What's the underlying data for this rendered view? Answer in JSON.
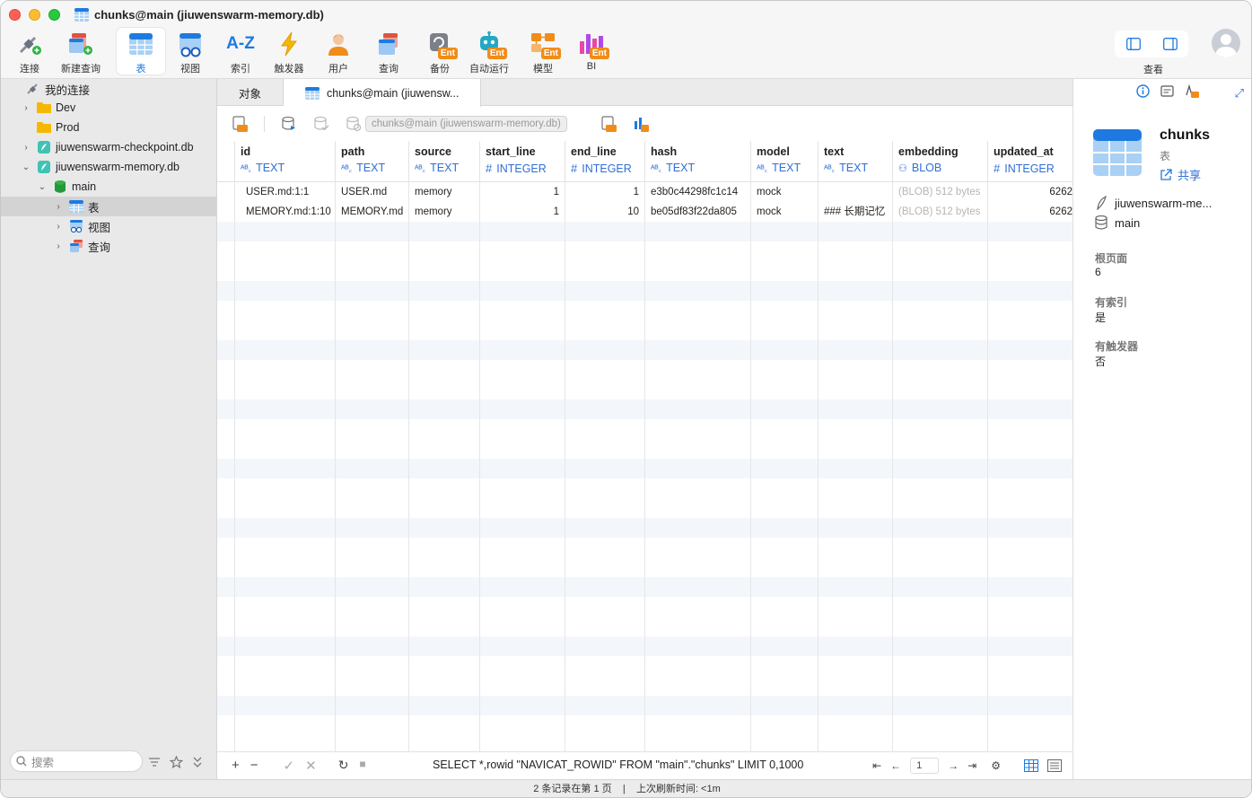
{
  "window": {
    "title": "chunks@main (jiuwenswarm-memory.db)"
  },
  "toolbar": {
    "items": [
      {
        "label": "连接"
      },
      {
        "label": "新建查询"
      },
      {
        "label": "表"
      },
      {
        "label": "视图"
      },
      {
        "label": "索引"
      },
      {
        "label": "触发器"
      },
      {
        "label": "用户"
      },
      {
        "label": "查询"
      },
      {
        "label": "备份"
      },
      {
        "label": "自动运行"
      },
      {
        "label": "模型"
      },
      {
        "label": "BI"
      }
    ],
    "ent_badge": "Ent",
    "view_label": "查看",
    "index_icon_text": "A-Z"
  },
  "sidebar": {
    "root": "我的连接",
    "items": [
      {
        "label": "Dev"
      },
      {
        "label": "Prod"
      },
      {
        "label": "jiuwenswarm-checkpoint.db"
      },
      {
        "label": "jiuwenswarm-memory.db"
      },
      {
        "label": "main"
      },
      {
        "label": "表"
      },
      {
        "label": "视图"
      },
      {
        "label": "查询"
      }
    ],
    "search_placeholder": "搜索"
  },
  "tabs": {
    "objects": "对象",
    "active": "chunks@main (jiuwensw..."
  },
  "grid_toolbar": {
    "tooltip": "chunks@main (jiuwenswarm-memory.db)"
  },
  "grid": {
    "columns": [
      {
        "name": "id",
        "type": "TEXT"
      },
      {
        "name": "path",
        "type": "TEXT"
      },
      {
        "name": "source",
        "type": "TEXT"
      },
      {
        "name": "start_line",
        "type": "INTEGER"
      },
      {
        "name": "end_line",
        "type": "INTEGER"
      },
      {
        "name": "hash",
        "type": "TEXT"
      },
      {
        "name": "model",
        "type": "TEXT"
      },
      {
        "name": "text",
        "type": "TEXT"
      },
      {
        "name": "embedding",
        "type": "BLOB"
      },
      {
        "name": "updated_at",
        "type": "INTEGER"
      }
    ],
    "rows": [
      [
        "USER.md:1:1",
        "USER.md",
        "memory",
        "1",
        "1",
        "e3b0c44298fc1c14",
        "mock",
        "",
        "(BLOB) 512 bytes",
        "6262"
      ],
      [
        "MEMORY.md:1:10",
        "MEMORY.md",
        "memory",
        "1",
        "10",
        "be05df83f22da805",
        "mock",
        "### 长期记忆",
        "(BLOB) 512 bytes",
        "6262"
      ]
    ]
  },
  "bottom": {
    "sql": "SELECT *,rowid \"NAVICAT_ROWID\" FROM \"main\".\"chunks\" LIMIT 0,1000",
    "page": "1"
  },
  "status": {
    "text": "2 条记录在第 1 页    |    上次刷新时间: <1m"
  },
  "rpanel": {
    "name": "chunks",
    "type": "表",
    "share": "共享",
    "db": "jiuwenswarm-me...",
    "schema": "main",
    "props": [
      {
        "label": "根页面",
        "value": "6"
      },
      {
        "label": "有索引",
        "value": "是"
      },
      {
        "label": "有触发器",
        "value": "否"
      }
    ]
  },
  "colors": {
    "accent": "#2f6fd6",
    "ent": "#f08c1a",
    "selected_row": "#d3d3d3"
  }
}
